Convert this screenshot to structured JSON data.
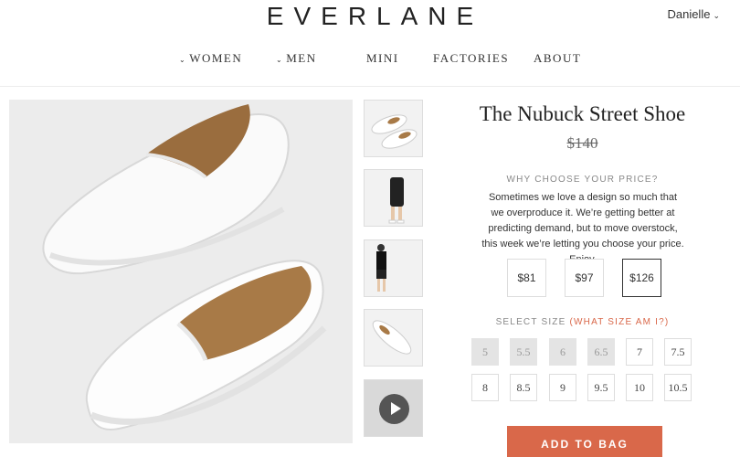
{
  "header": {
    "logo": "EVERLANE",
    "user": "Danielle"
  },
  "nav": {
    "items": [
      "WOMEN",
      "MEN",
      "MINI",
      "FACTORIES",
      "ABOUT"
    ]
  },
  "product": {
    "title": "The Nubuck Street Shoe",
    "original_price": "$140",
    "why_heading": "WHY CHOOSE YOUR PRICE?",
    "description": "Sometimes we love a design so much that we overproduce it. We’re getting better at predicting demand, but to move overstock, this week we’re letting you choose your price. Enjoy.",
    "price_options": [
      "$81",
      "$97",
      "$126"
    ],
    "selected_price": "$126",
    "size_heading": "SELECT SIZE",
    "size_help": "(WHAT SIZE AM I?)",
    "sizes": [
      {
        "label": "5",
        "available": false
      },
      {
        "label": "5.5",
        "available": false
      },
      {
        "label": "6",
        "available": false
      },
      {
        "label": "6.5",
        "available": false
      },
      {
        "label": "7",
        "available": true
      },
      {
        "label": "7.5",
        "available": true
      },
      {
        "label": "8",
        "available": true
      },
      {
        "label": "8.5",
        "available": true
      },
      {
        "label": "9",
        "available": true
      },
      {
        "label": "9.5",
        "available": true
      },
      {
        "label": "10",
        "available": true
      },
      {
        "label": "10.5",
        "available": true
      }
    ],
    "add_to_bag": "ADD TO BAG"
  },
  "colors": {
    "accent": "#d9684a",
    "unavailable_size": "#e4e4e4"
  }
}
